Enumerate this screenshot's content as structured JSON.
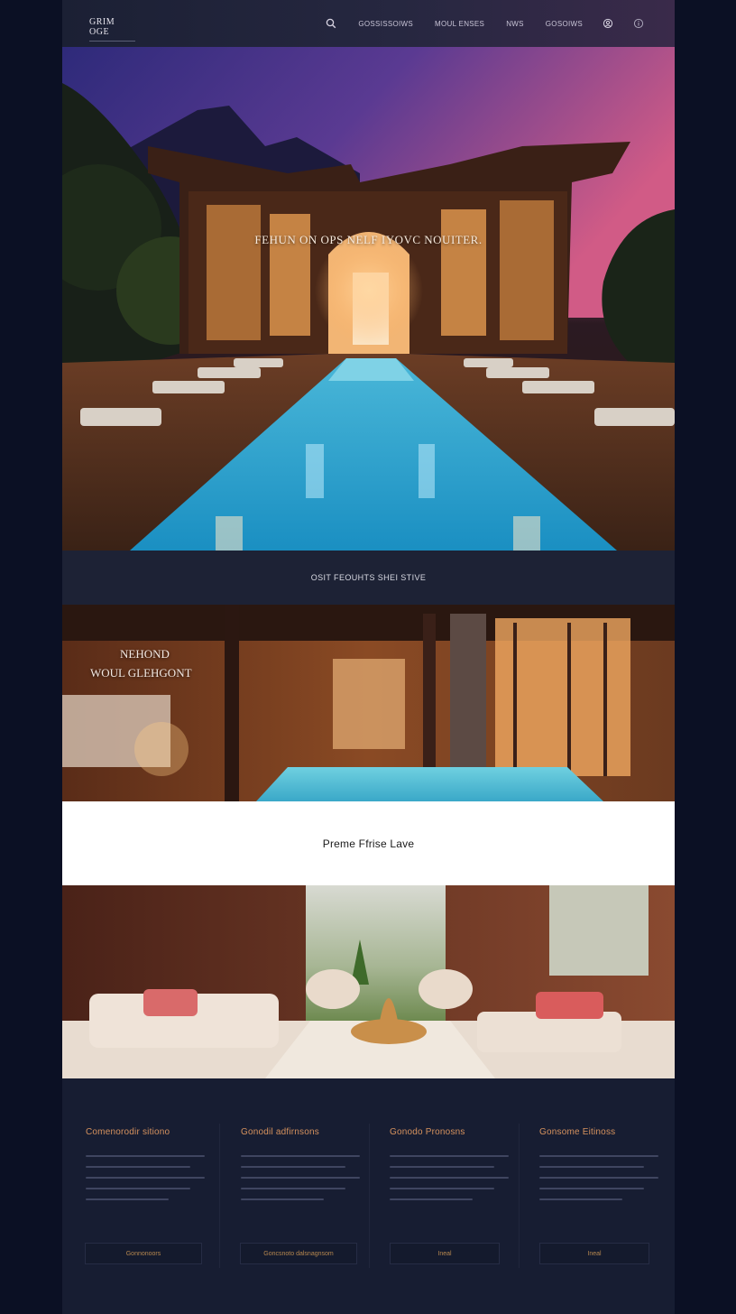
{
  "nav": {
    "logo": "GRIM OGE",
    "links": [
      "GOSSISSOIWS",
      "MOUL ENSES",
      "NWS",
      "GOSOIWS"
    ]
  },
  "hero": {
    "title": "FEHUN ON OPS NELF IYOVC NOUITER."
  },
  "band": {
    "text": "OSIT FEOUHTS SHEI STIVE"
  },
  "spa": {
    "heading_line1": "NEHOND",
    "heading_line2": "WOUL GLEHGONT"
  },
  "white_band": {
    "text": "Preme Ffrise Lave"
  },
  "features": [
    {
      "title": "Comenorodir sitiono",
      "button": "Gonnonoors"
    },
    {
      "title": "Gonodil adfirnsons",
      "button": "Goncsnoto dalsnagnsom"
    },
    {
      "title": "Gonodo Pronosns",
      "button": "Ineal"
    },
    {
      "title": "Gonsome Eitinoss",
      "button": "Ineal"
    }
  ],
  "colors": {
    "accent": "#d6925e",
    "background": "#161c30",
    "outer": "#0b1024"
  }
}
